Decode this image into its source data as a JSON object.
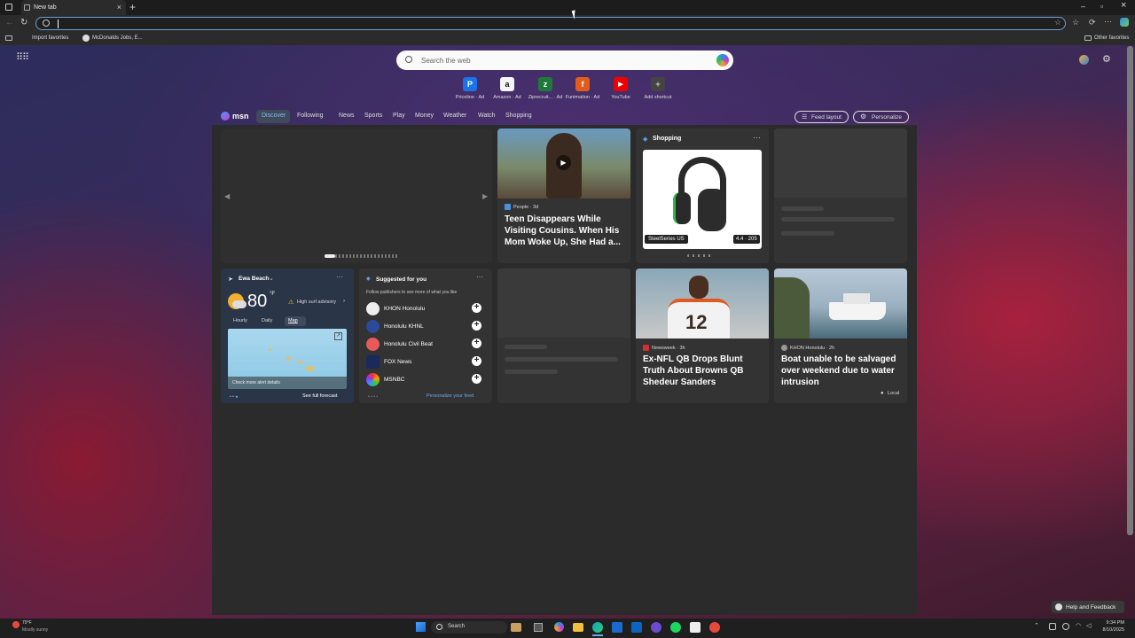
{
  "browser": {
    "tab_title": "New tab",
    "new_tab": "+",
    "minimize": "–",
    "maximize": "▫",
    "close": "×",
    "address_placeholder": "",
    "favorites": [
      "Import favorites",
      "McDonalds Jobs, E...",
      "Other favorites"
    ]
  },
  "search": {
    "placeholder": "Search the web"
  },
  "shortcuts": [
    {
      "label": "Priceline · Ad",
      "glyph": "P",
      "color": "#1a73e8"
    },
    {
      "label": "Amazon · Ad",
      "glyph": "a",
      "color": "#f5f5f5"
    },
    {
      "label": "Ziprecruit... · Ad",
      "glyph": "z",
      "color": "#1f7a3a"
    },
    {
      "label": "Funimation · Ad",
      "glyph": "f",
      "color": "#e35b1a"
    },
    {
      "label": "YouTube",
      "glyph": "▶",
      "color": "#e00"
    },
    {
      "label": "Add shortcut",
      "glyph": "+",
      "color": "#444"
    }
  ],
  "msn": {
    "brand": "msn",
    "nav": [
      "Discover",
      "Following",
      "News",
      "Sports",
      "Play",
      "Money",
      "Weather",
      "Watch",
      "Shopping"
    ],
    "feed_layout": "Feed layout",
    "personalize": "Personalize"
  },
  "cards": {
    "story1": {
      "source": "People · 3d",
      "title": "Teen Disappears While Visiting Cousins. When His Mom Woke Up, She Had a..."
    },
    "shopping": {
      "header": "Shopping",
      "brand": "SteelSeries US",
      "price": "4.4 · 205"
    },
    "weather": {
      "location": "Ewa Beach",
      "temp": "80",
      "unit": "°F",
      "alert": "High surf advisory",
      "tabs": [
        "Hourly",
        "Daily",
        "Map"
      ],
      "map_link": "Check more alert details",
      "forecast_link": "See full forecast"
    },
    "suggested": {
      "header": "Suggested for you",
      "sub": "Follow publishers to see more of what you like",
      "publishers": [
        "KHON Honolulu",
        "Honolulu KHNL",
        "Honolulu Civil Beat",
        "FOX News",
        "MSNBC"
      ],
      "personalize_link": "Personalize your feed"
    },
    "story2": {
      "source": "Newsweek · 3h",
      "title": "Ex-NFL QB Drops Blunt Truth About Browns QB Shedeur Sanders"
    },
    "story3": {
      "source": "KHON Honolulu · 2h",
      "title": "Boat unable to be salvaged over weekend due to water intrusion",
      "tag": "Local"
    }
  },
  "help": "Help and Feedback",
  "taskbar": {
    "weather_temp": "79°F",
    "weather_desc": "Mostly sunny",
    "search": "Search",
    "time": "9:34 PM",
    "date": "8/10/2025"
  }
}
